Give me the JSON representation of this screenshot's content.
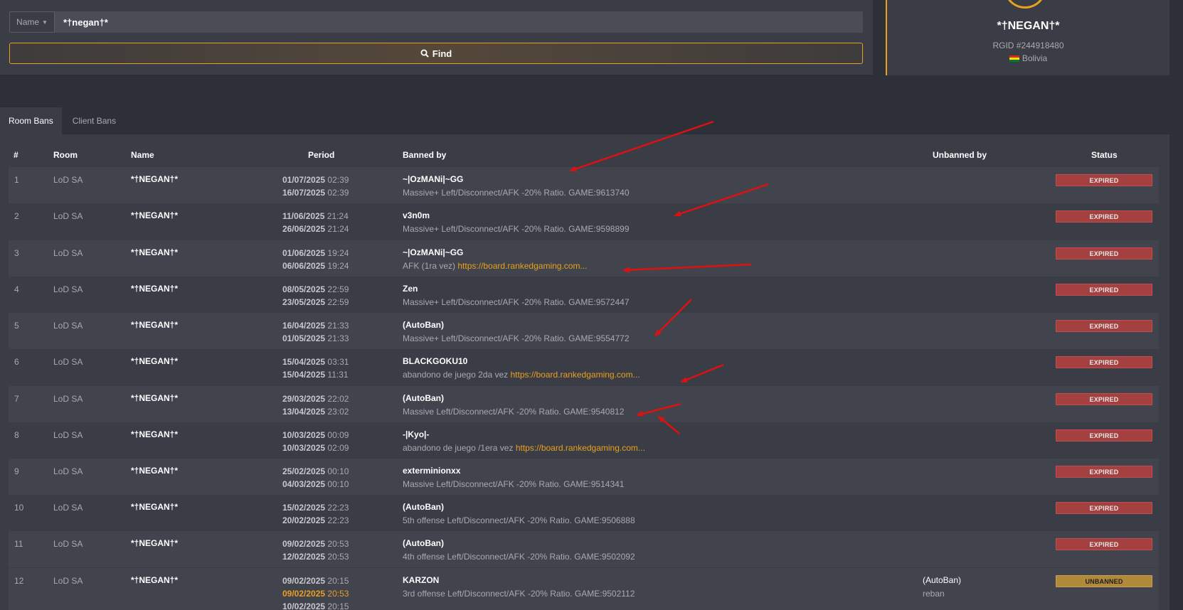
{
  "search": {
    "type_label": "Name",
    "value": "*†negan†*",
    "find_label": "Find"
  },
  "profile": {
    "name": "*†NEGAN†*",
    "rgid": "RGID #244918480",
    "country": "Bolivia"
  },
  "tabs": [
    {
      "label": "Room Bans",
      "active": true
    },
    {
      "label": "Client Bans",
      "active": false
    }
  ],
  "table": {
    "headers": {
      "num": "#",
      "room": "Room",
      "name": "Name",
      "period": "Period",
      "banned_by": "Banned by",
      "unbanned_by": "Unbanned by",
      "status": "Status"
    },
    "rows": [
      {
        "num": "1",
        "room": "LoD SA",
        "name": "*†NEGAN†*",
        "start_date": "01/07/2025",
        "start_time": "02:39",
        "end_date": "16/07/2025",
        "end_time": "02:39",
        "banned_by": "~|OzMANi|~GG",
        "reason": "Massive+ Left/Disconnect/AFK -20% Ratio. GAME:9613740",
        "link": "",
        "status": "EXPIRED"
      },
      {
        "num": "2",
        "room": "LoD SA",
        "name": "*†NEGAN†*",
        "start_date": "11/06/2025",
        "start_time": "21:24",
        "end_date": "26/06/2025",
        "end_time": "21:24",
        "banned_by": "v3n0m",
        "reason": "Massive+ Left/Disconnect/AFK -20% Ratio. GAME:9598899",
        "link": "",
        "status": "EXPIRED"
      },
      {
        "num": "3",
        "room": "LoD SA",
        "name": "*†NEGAN†*",
        "start_date": "01/06/2025",
        "start_time": "19:24",
        "end_date": "06/06/2025",
        "end_time": "19:24",
        "banned_by": "~|OzMANi|~GG",
        "reason": "AFK (1ra vez)",
        "link": "https://board.rankedgaming.com...",
        "status": "EXPIRED"
      },
      {
        "num": "4",
        "room": "LoD SA",
        "name": "*†NEGAN†*",
        "start_date": "08/05/2025",
        "start_time": "22:59",
        "end_date": "23/05/2025",
        "end_time": "22:59",
        "banned_by": "Zen",
        "reason": "Massive+ Left/Disconnect/AFK -20% Ratio. GAME:9572447",
        "link": "",
        "status": "EXPIRED"
      },
      {
        "num": "5",
        "room": "LoD SA",
        "name": "*†NEGAN†*",
        "start_date": "16/04/2025",
        "start_time": "21:33",
        "end_date": "01/05/2025",
        "end_time": "21:33",
        "banned_by": "(AutoBan)",
        "reason": "Massive+ Left/Disconnect/AFK -20% Ratio. GAME:9554772",
        "link": "",
        "status": "EXPIRED"
      },
      {
        "num": "6",
        "room": "LoD SA",
        "name": "*†NEGAN†*",
        "start_date": "15/04/2025",
        "start_time": "03:31",
        "end_date": "15/04/2025",
        "end_time": "11:31",
        "banned_by": "BLACKGOKU10",
        "reason": "abandono de juego 2da vez",
        "link": "https://board.rankedgaming.com...",
        "status": "EXPIRED"
      },
      {
        "num": "7",
        "room": "LoD SA",
        "name": "*†NEGAN†*",
        "start_date": "29/03/2025",
        "start_time": "22:02",
        "end_date": "13/04/2025",
        "end_time": "23:02",
        "banned_by": "(AutoBan)",
        "reason": "Massive Left/Disconnect/AFK -20% Ratio. GAME:9540812",
        "link": "",
        "status": "EXPIRED"
      },
      {
        "num": "8",
        "room": "LoD SA",
        "name": "*†NEGAN†*",
        "start_date": "10/03/2025",
        "start_time": "00:09",
        "end_date": "10/03/2025",
        "end_time": "02:09",
        "banned_by": "-|Kyo|-",
        "reason": "abandono de juego /1era vez",
        "link": "https://board.rankedgaming.com...",
        "status": "EXPIRED"
      },
      {
        "num": "9",
        "room": "LoD SA",
        "name": "*†NEGAN†*",
        "start_date": "25/02/2025",
        "start_time": "00:10",
        "end_date": "04/03/2025",
        "end_time": "00:10",
        "banned_by": "exterminionxx",
        "reason": "Massive Left/Disconnect/AFK -20% Ratio. GAME:9514341",
        "link": "",
        "status": "EXPIRED"
      },
      {
        "num": "10",
        "room": "LoD SA",
        "name": "*†NEGAN†*",
        "start_date": "15/02/2025",
        "start_time": "22:23",
        "end_date": "20/02/2025",
        "end_time": "22:23",
        "banned_by": "(AutoBan)",
        "reason": "5th offense Left/Disconnect/AFK -20% Ratio. GAME:9506888",
        "link": "",
        "status": "EXPIRED"
      },
      {
        "num": "11",
        "room": "LoD SA",
        "name": "*†NEGAN†*",
        "start_date": "09/02/2025",
        "start_time": "20:53",
        "end_date": "12/02/2025",
        "end_time": "20:53",
        "banned_by": "(AutoBan)",
        "reason": "4th offense Left/Disconnect/AFK -20% Ratio. GAME:9502092",
        "link": "",
        "status": "EXPIRED"
      }
    ],
    "row12": {
      "num": "12",
      "room": "LoD SA",
      "name": "*†NEGAN†*",
      "start_date": "09/02/2025",
      "start_time": "20:15",
      "unban_date": "09/02/2025",
      "unban_time": "20:53",
      "end_date": "10/02/2025",
      "end_time": "20:15",
      "banned_by": "KARZON",
      "reason": "3rd offense Left/Disconnect/AFK -20% Ratio. GAME:9502112",
      "unbanned_by": "(AutoBan)",
      "unban_reason": "reban",
      "status": "UNBANNED"
    }
  },
  "colors": {
    "accent": "#e8a020",
    "expired": "#a54040",
    "unbanned": "#b08a3a",
    "annotation_arrow": "#e01010"
  }
}
